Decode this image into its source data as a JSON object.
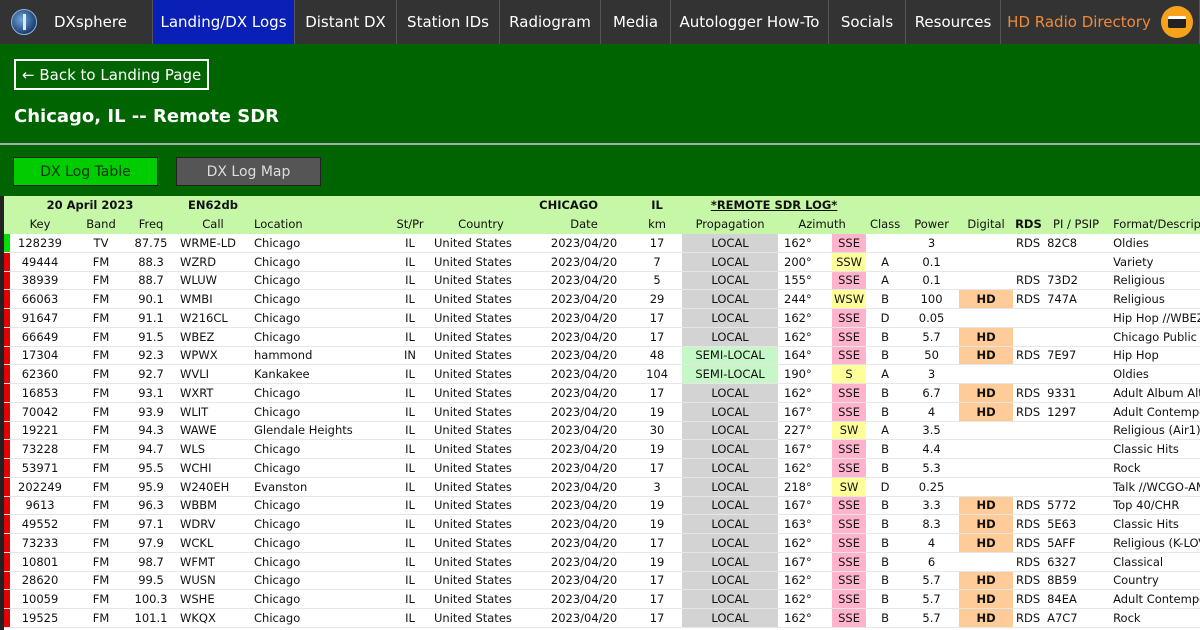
{
  "nav": {
    "brand": "DXsphere",
    "items": [
      "Landing/DX Logs",
      "Distant DX",
      "Station IDs",
      "Radiogram",
      "Media",
      "Autologger How-To",
      "Socials",
      "Resources",
      "HD Radio Directory"
    ],
    "active_index": 0,
    "colors": {
      "bar": "#333333",
      "active": "#0a1fb5",
      "hd_text": "#f0893a"
    }
  },
  "back_button": "← Back to Landing Page",
  "page_title": "Chicago, IL -- Remote SDR",
  "tabs": {
    "table": "DX Log Table",
    "map": "DX Log Map"
  },
  "summary": {
    "date": "20 April 2023",
    "grid": "EN62db",
    "city": "CHICAGO",
    "state": "IL",
    "log_label": "*REMOTE SDR LOG*"
  },
  "headers": [
    "Key",
    "Band",
    "Freq",
    "Call",
    "Location",
    "St/Pr",
    "Country",
    "Date",
    "km",
    "Propagation",
    "Azimuth",
    "",
    "Class",
    "Power",
    "Digital",
    "RDS",
    "PI / PSIP",
    "Format/Description"
  ],
  "rows": [
    {
      "key": "128239",
      "band": "TV",
      "freq": "87.75",
      "call": "WRME-LD",
      "loc": "Chicago",
      "st": "IL",
      "country": "United States",
      "date": "2023/04/20",
      "km": "17",
      "prop": "LOCAL",
      "az": "162°",
      "dir": "SSE",
      "class": "",
      "power": "3",
      "digital": "",
      "rds": "RDS",
      "pi": "82C8",
      "format": "Oldies",
      "flag": "green"
    },
    {
      "key": "49444",
      "band": "FM",
      "freq": "88.3",
      "call": "WZRD",
      "loc": "Chicago",
      "st": "IL",
      "country": "United States",
      "date": "2023/04/20",
      "km": "7",
      "prop": "LOCAL",
      "az": "200°",
      "dir": "SSW",
      "class": "A",
      "power": "0.1",
      "digital": "",
      "rds": "",
      "pi": "",
      "format": "Variety",
      "flag": "red"
    },
    {
      "key": "38939",
      "band": "FM",
      "freq": "88.7",
      "call": "WLUW",
      "loc": "Chicago",
      "st": "IL",
      "country": "United States",
      "date": "2023/04/20",
      "km": "5",
      "prop": "LOCAL",
      "az": "155°",
      "dir": "SSE",
      "class": "A",
      "power": "0.1",
      "digital": "",
      "rds": "RDS",
      "pi": "73D2",
      "format": "Religious",
      "flag": "red"
    },
    {
      "key": "66063",
      "band": "FM",
      "freq": "90.1",
      "call": "WMBI",
      "loc": "Chicago",
      "st": "IL",
      "country": "United States",
      "date": "2023/04/20",
      "km": "29",
      "prop": "LOCAL",
      "az": "244°",
      "dir": "WSW",
      "class": "B",
      "power": "100",
      "digital": "HD",
      "rds": "RDS",
      "pi": "747A",
      "format": "Religious",
      "flag": "red"
    },
    {
      "key": "91647",
      "band": "FM",
      "freq": "91.1",
      "call": "W216CL",
      "loc": "Chicago",
      "st": "IL",
      "country": "United States",
      "date": "2023/04/20",
      "km": "17",
      "prop": "LOCAL",
      "az": "162°",
      "dir": "SSE",
      "class": "D",
      "power": "0.05",
      "digital": "",
      "rds": "",
      "pi": "",
      "format": "Hip Hop //WBEZ",
      "flag": "red"
    },
    {
      "key": "66649",
      "band": "FM",
      "freq": "91.5",
      "call": "WBEZ",
      "loc": "Chicago",
      "st": "IL",
      "country": "United States",
      "date": "2023/04/20",
      "km": "17",
      "prop": "LOCAL",
      "az": "162°",
      "dir": "SSE",
      "class": "B",
      "power": "5.7",
      "digital": "HD",
      "rds": "",
      "pi": "",
      "format": "Chicago Public R",
      "flag": "red"
    },
    {
      "key": "17304",
      "band": "FM",
      "freq": "92.3",
      "call": "WPWX",
      "loc": "hammond",
      "st": "IN",
      "country": "United States",
      "date": "2023/04/20",
      "km": "48",
      "prop": "SEMI-LOCAL",
      "az": "164°",
      "dir": "SSE",
      "class": "B",
      "power": "50",
      "digital": "HD",
      "rds": "RDS",
      "pi": "7E97",
      "format": "Hip Hop",
      "flag": "red"
    },
    {
      "key": "62360",
      "band": "FM",
      "freq": "92.7",
      "call": "WVLI",
      "loc": "Kankakee",
      "st": "IL",
      "country": "United States",
      "date": "2023/04/20",
      "km": "104",
      "prop": "SEMI-LOCAL",
      "az": "190°",
      "dir": "S",
      "class": "A",
      "power": "3",
      "digital": "",
      "rds": "",
      "pi": "",
      "format": "Oldies",
      "flag": "red"
    },
    {
      "key": "16853",
      "band": "FM",
      "freq": "93.1",
      "call": "WXRT",
      "loc": "Chicago",
      "st": "IL",
      "country": "United States",
      "date": "2023/04/20",
      "km": "17",
      "prop": "LOCAL",
      "az": "162°",
      "dir": "SSE",
      "class": "B",
      "power": "6.7",
      "digital": "HD",
      "rds": "RDS",
      "pi": "9331",
      "format": "Adult Album Alte",
      "flag": "red"
    },
    {
      "key": "70042",
      "band": "FM",
      "freq": "93.9",
      "call": "WLIT",
      "loc": "Chicago",
      "st": "IL",
      "country": "United States",
      "date": "2023/04/20",
      "km": "19",
      "prop": "LOCAL",
      "az": "167°",
      "dir": "SSE",
      "class": "B",
      "power": "4",
      "digital": "HD",
      "rds": "RDS",
      "pi": "1297",
      "format": "Adult Contempo",
      "flag": "red"
    },
    {
      "key": "19221",
      "band": "FM",
      "freq": "94.3",
      "call": "WAWE",
      "loc": "Glendale Heights",
      "st": "IL",
      "country": "United States",
      "date": "2023/04/20",
      "km": "30",
      "prop": "LOCAL",
      "az": "227°",
      "dir": "SW",
      "class": "A",
      "power": "3.5",
      "digital": "",
      "rds": "",
      "pi": "",
      "format": "Religious (Air1)",
      "flag": "red"
    },
    {
      "key": "73228",
      "band": "FM",
      "freq": "94.7",
      "call": "WLS",
      "loc": "Chicago",
      "st": "IL",
      "country": "United States",
      "date": "2023/04/20",
      "km": "19",
      "prop": "LOCAL",
      "az": "167°",
      "dir": "SSE",
      "class": "B",
      "power": "4.4",
      "digital": "",
      "rds": "",
      "pi": "",
      "format": "Classic Hits",
      "flag": "red"
    },
    {
      "key": "53971",
      "band": "FM",
      "freq": "95.5",
      "call": "WCHI",
      "loc": "Chicago",
      "st": "IL",
      "country": "United States",
      "date": "2023/04/20",
      "km": "17",
      "prop": "LOCAL",
      "az": "162°",
      "dir": "SSE",
      "class": "B",
      "power": "5.3",
      "digital": "",
      "rds": "",
      "pi": "",
      "format": "Rock",
      "flag": "red"
    },
    {
      "key": "202249",
      "band": "FM",
      "freq": "95.9",
      "call": "W240EH",
      "loc": "Evanston",
      "st": "IL",
      "country": "United States",
      "date": "2023/04/20",
      "km": "3",
      "prop": "LOCAL",
      "az": "218°",
      "dir": "SW",
      "class": "D",
      "power": "0.25",
      "digital": "",
      "rds": "",
      "pi": "",
      "format": "Talk //WCGO-AM",
      "flag": "red"
    },
    {
      "key": "9613",
      "band": "FM",
      "freq": "96.3",
      "call": "WBBM",
      "loc": "Chicago",
      "st": "IL",
      "country": "United States",
      "date": "2023/04/20",
      "km": "19",
      "prop": "LOCAL",
      "az": "167°",
      "dir": "SSE",
      "class": "B",
      "power": "3.3",
      "digital": "HD",
      "rds": "RDS",
      "pi": "5772",
      "format": "Top 40/CHR",
      "flag": "red"
    },
    {
      "key": "49552",
      "band": "FM",
      "freq": "97.1",
      "call": "WDRV",
      "loc": "Chicago",
      "st": "IL",
      "country": "United States",
      "date": "2023/04/20",
      "km": "19",
      "prop": "LOCAL",
      "az": "163°",
      "dir": "SSE",
      "class": "B",
      "power": "8.3",
      "digital": "HD",
      "rds": "RDS",
      "pi": "5E63",
      "format": "Classic Hits",
      "flag": "red"
    },
    {
      "key": "73233",
      "band": "FM",
      "freq": "97.9",
      "call": "WCKL",
      "loc": "Chicago",
      "st": "IL",
      "country": "United States",
      "date": "2023/04/20",
      "km": "17",
      "prop": "LOCAL",
      "az": "162°",
      "dir": "SSE",
      "class": "B",
      "power": "4",
      "digital": "HD",
      "rds": "RDS",
      "pi": "5AFF",
      "format": "Religious (K-LOV",
      "flag": "red"
    },
    {
      "key": "10801",
      "band": "FM",
      "freq": "98.7",
      "call": "WFMT",
      "loc": "Chicago",
      "st": "IL",
      "country": "United States",
      "date": "2023/04/20",
      "km": "19",
      "prop": "LOCAL",
      "az": "167°",
      "dir": "SSE",
      "class": "B",
      "power": "6",
      "digital": "",
      "rds": "RDS",
      "pi": "6327",
      "format": "Classical",
      "flag": "red"
    },
    {
      "key": "28620",
      "band": "FM",
      "freq": "99.5",
      "call": "WUSN",
      "loc": "Chicago",
      "st": "IL",
      "country": "United States",
      "date": "2023/04/20",
      "km": "17",
      "prop": "LOCAL",
      "az": "162°",
      "dir": "SSE",
      "class": "B",
      "power": "5.7",
      "digital": "HD",
      "rds": "RDS",
      "pi": "8B59",
      "format": "Country",
      "flag": "red"
    },
    {
      "key": "10059",
      "band": "FM",
      "freq": "100.3",
      "call": "WSHE",
      "loc": "Chicago",
      "st": "IL",
      "country": "United States",
      "date": "2023/04/20",
      "km": "17",
      "prop": "LOCAL",
      "az": "162°",
      "dir": "SSE",
      "class": "B",
      "power": "5.7",
      "digital": "HD",
      "rds": "RDS",
      "pi": "84EA",
      "format": "Adult Contempo",
      "flag": "red"
    },
    {
      "key": "19525",
      "band": "FM",
      "freq": "101.1",
      "call": "WKQX",
      "loc": "Chicago",
      "st": "IL",
      "country": "United States",
      "date": "2023/04/20",
      "km": "17",
      "prop": "LOCAL",
      "az": "162°",
      "dir": "SSE",
      "class": "B",
      "power": "5.7",
      "digital": "HD",
      "rds": "RDS",
      "pi": "A7C7",
      "format": "Rock",
      "flag": "red"
    }
  ]
}
